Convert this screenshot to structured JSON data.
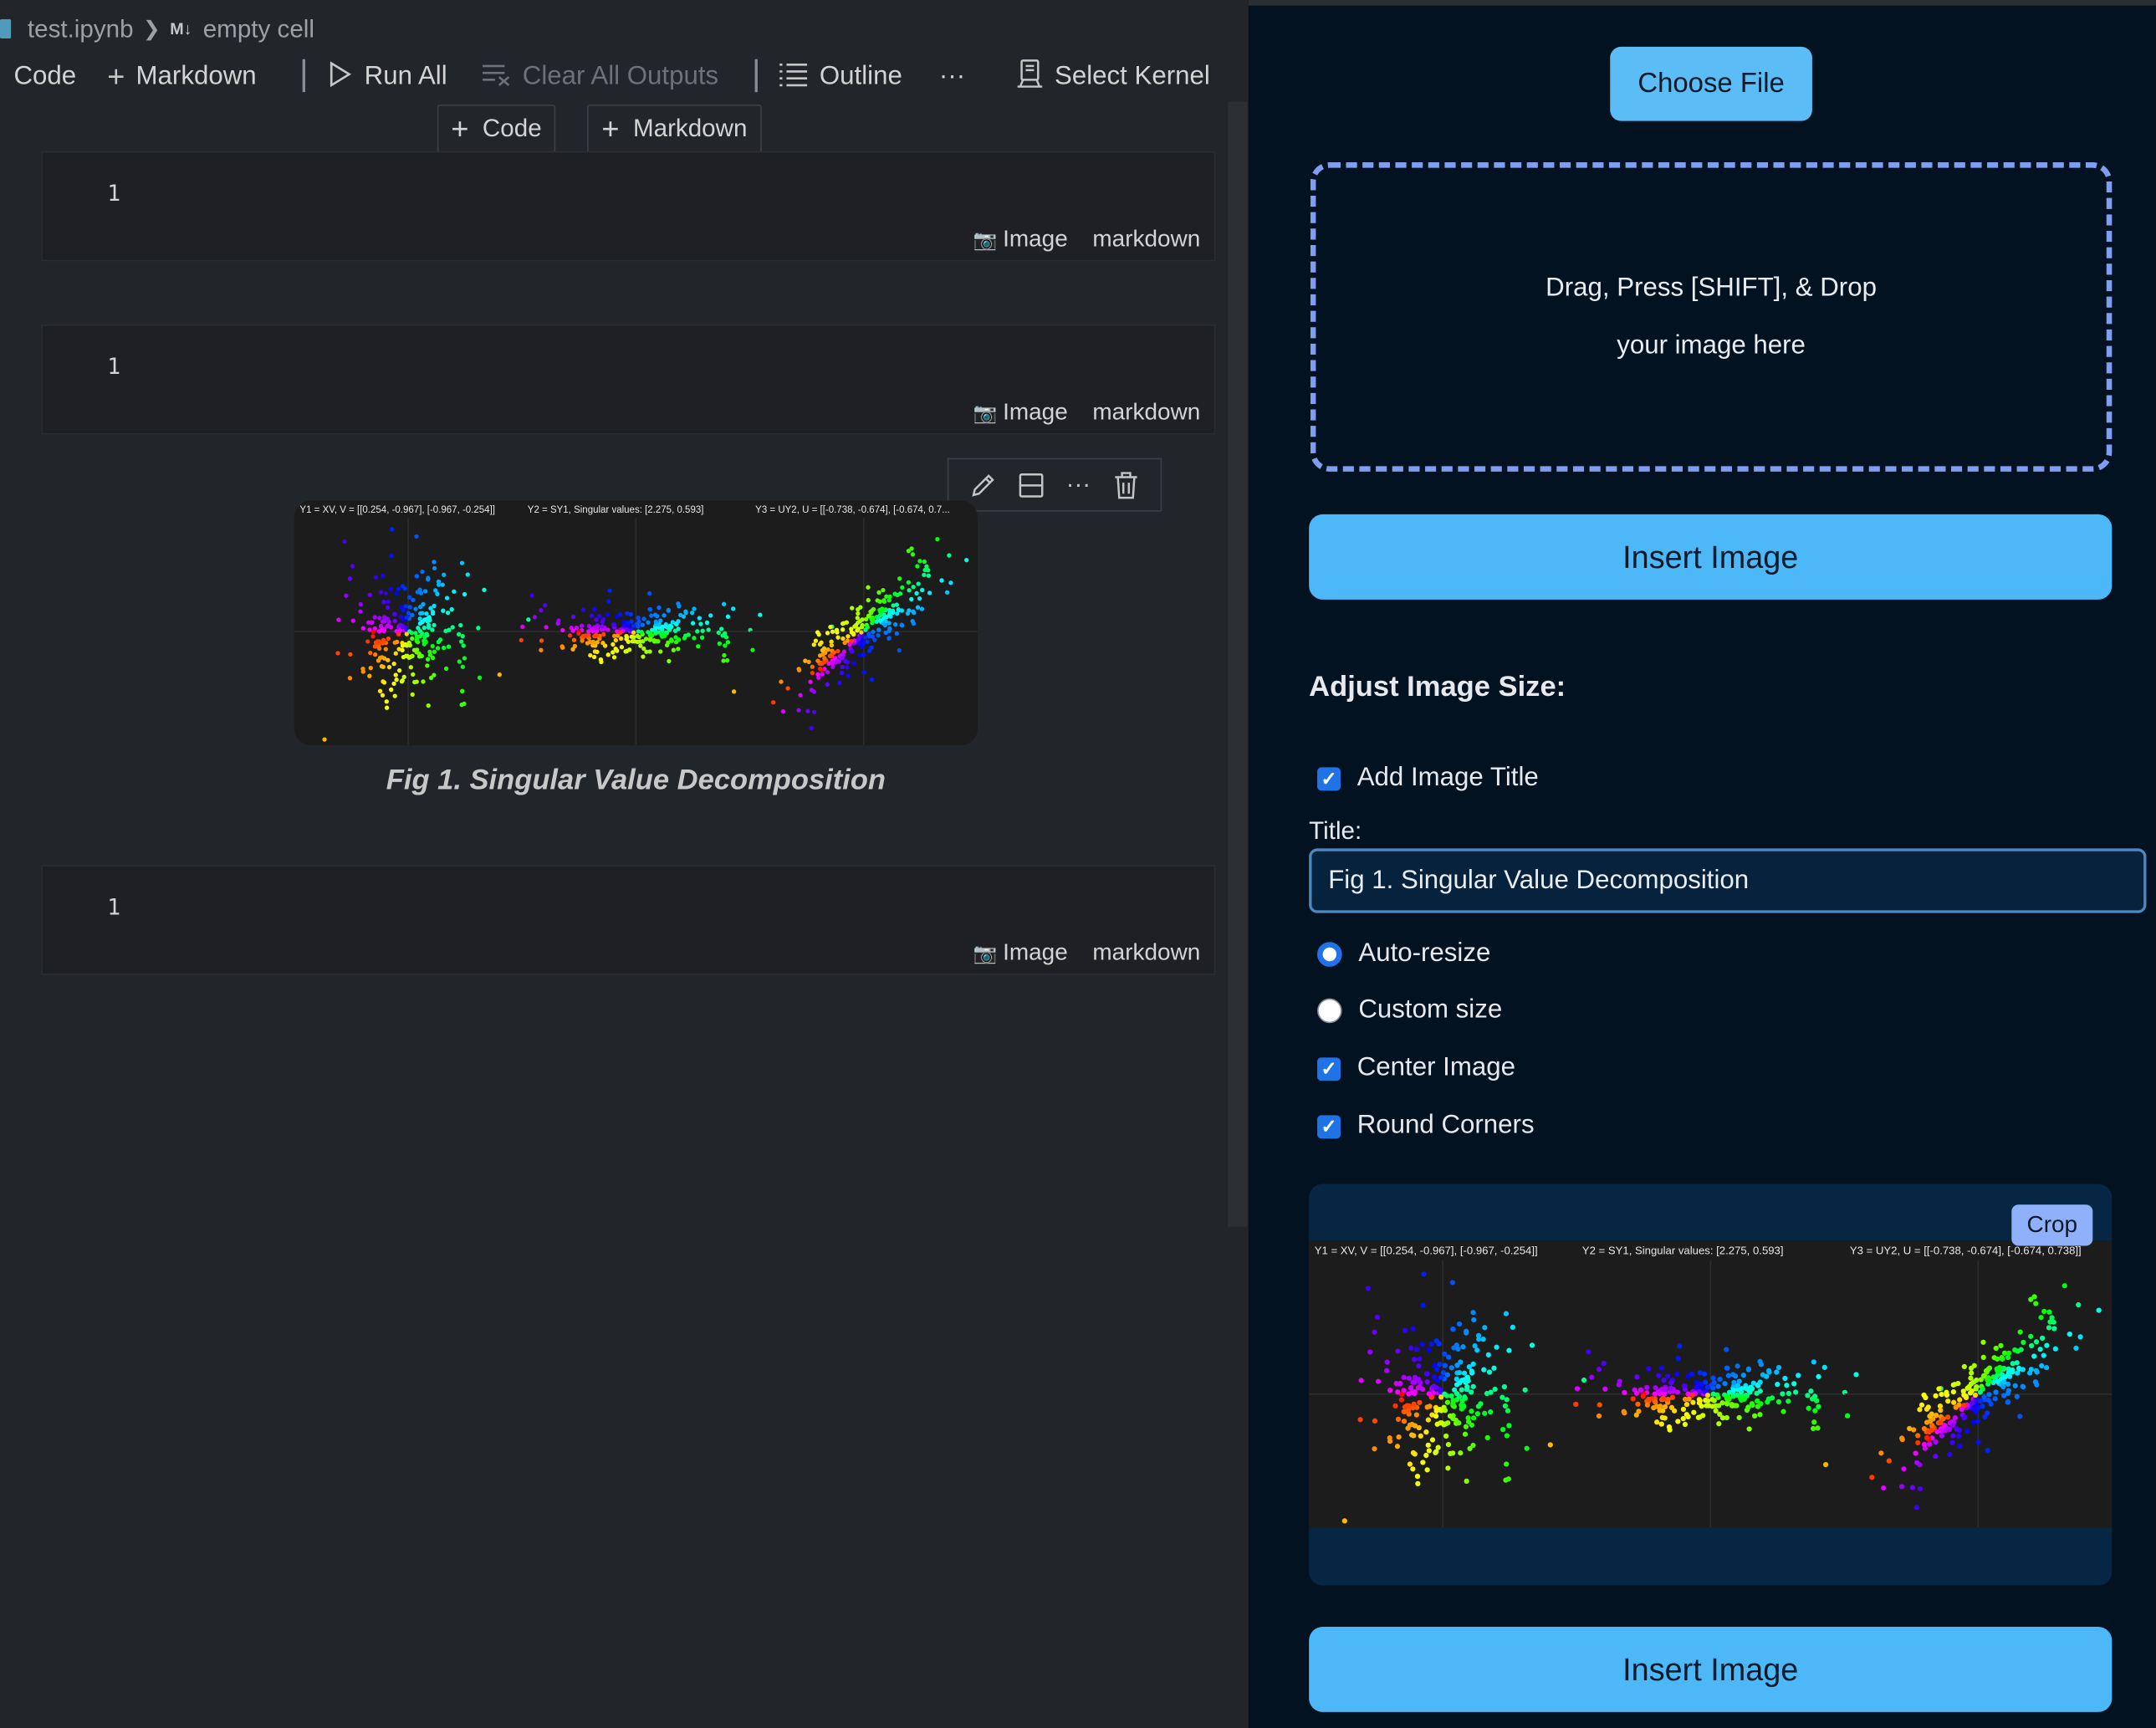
{
  "breadcrumb": {
    "file": "test.ipynb",
    "md_badge": "M↓",
    "cell": "empty cell"
  },
  "toolbar": {
    "code": "Code",
    "markdown": "Markdown",
    "run_all": "Run All",
    "clear_outputs": "Clear All Outputs",
    "outline": "Outline",
    "more": "···",
    "select_kernel": "Select Kernel"
  },
  "insert_bar": {
    "code": "Code",
    "markdown": "Markdown"
  },
  "cells": [
    {
      "line": "1",
      "image_label": "Image",
      "lang": "markdown"
    },
    {
      "line": "1",
      "image_label": "Image",
      "lang": "markdown"
    },
    {
      "line": "1",
      "image_label": "Image",
      "lang": "markdown"
    }
  ],
  "figure": {
    "caption": "Fig 1. Singular Value Decomposition",
    "subplot_titles": [
      "Y1 = XV, V = [[0.254, -0.967], [-0.967, -0.254]]",
      "Y2 = SY1, Singular values: [2.275, 0.593]",
      "Y3 = UY2, U = [[-0.738, -0.674], [-0.674, 0.738]]"
    ],
    "inline_subplot_titles": [
      "Y1 = XV, V = [[0.254, -0.967], [-0.967, -0.254]]",
      "Y2 = SY1, Singular values: [2.275, 0.593]",
      "Y3 = UY2, U = [[-0.738, -0.674], [-0.674, 0.7..."
    ]
  },
  "panel": {
    "choose_file": "Choose File",
    "dropzone_line1": "Drag, Press [SHIFT], & Drop",
    "dropzone_line2": "your image here",
    "insert_image": "Insert Image",
    "adjust_title": "Adjust Image Size:",
    "add_title_label": "Add Image Title",
    "add_title_checked": true,
    "title_label": "Title:",
    "title_value": "Fig 1. Singular Value Decomposition",
    "auto_resize": "Auto-resize",
    "custom_size": "Custom size",
    "selected_size": "Auto-resize",
    "center_image": "Center Image",
    "center_checked": true,
    "round_corners": "Round Corners",
    "round_checked": true,
    "crop": "Crop",
    "insert_image_bottom": "Insert Image"
  },
  "colors": {
    "panel_bg": "#031221",
    "button_blue": "#4db8f8",
    "dropzone_border": "#7f9ef2",
    "checkbox": "#1f73e6"
  }
}
